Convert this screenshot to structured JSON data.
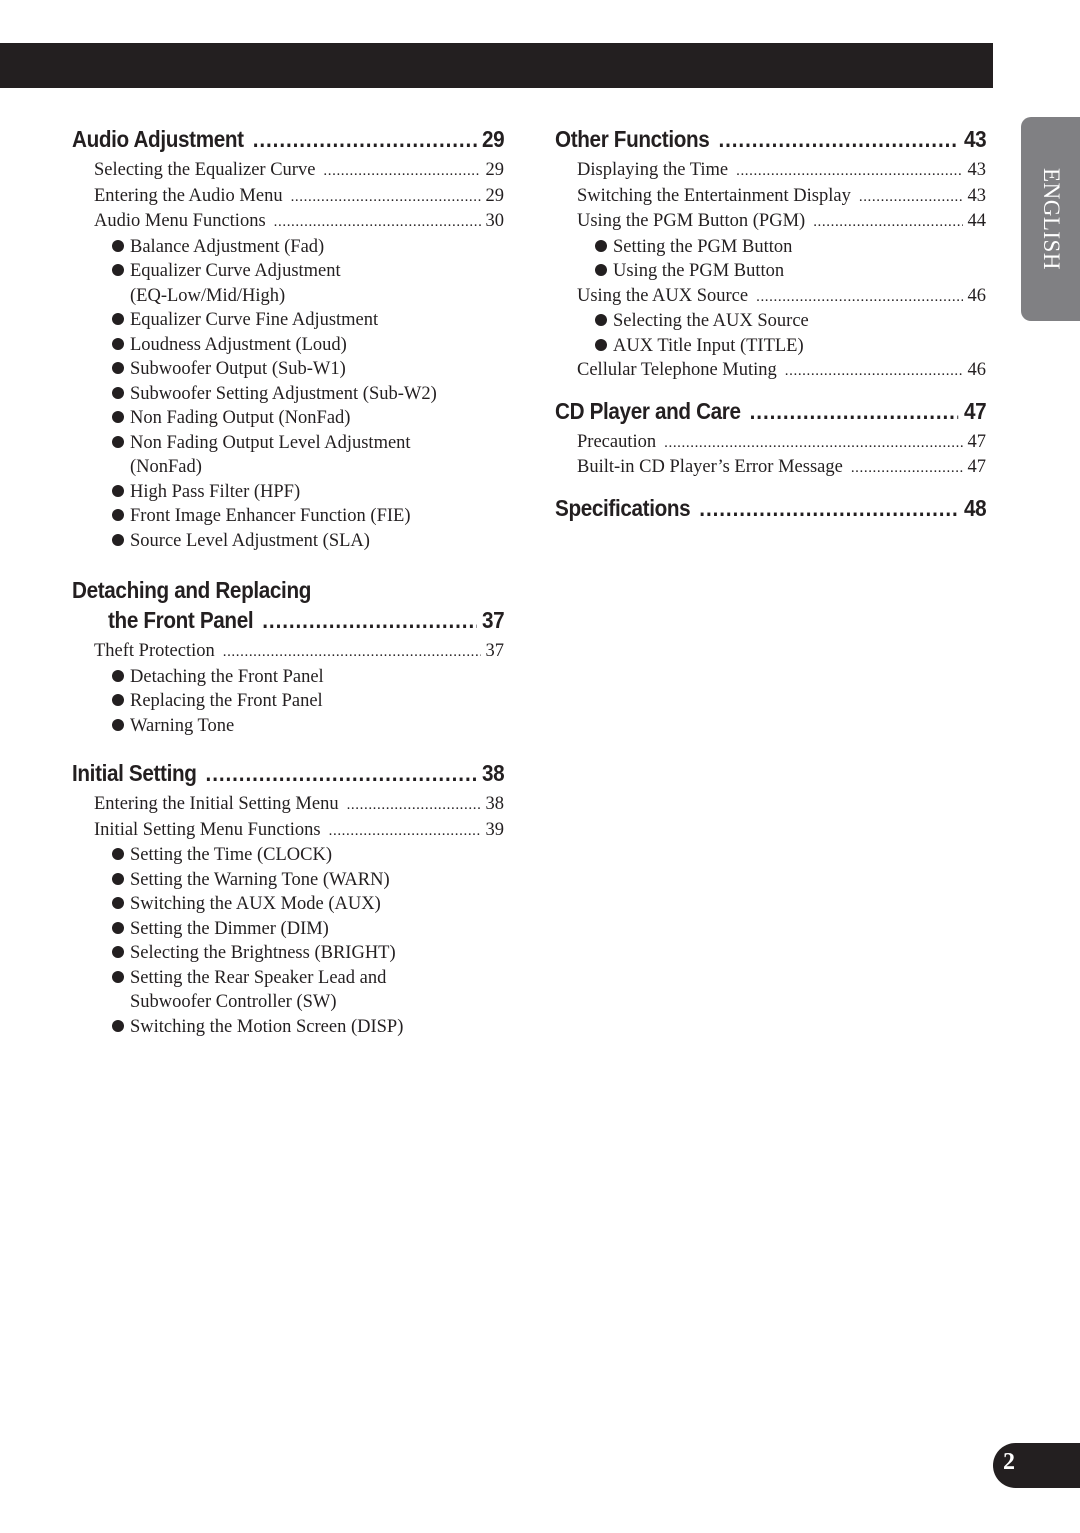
{
  "language_tab": "ENGLISH",
  "page_number": "2",
  "left_column": [
    {
      "title": "Audio Adjustment",
      "title_line2": null,
      "page": "29",
      "entries": [
        {
          "type": "entry",
          "label": "Selecting the Equalizer Curve",
          "page": "29"
        },
        {
          "type": "entry",
          "label": "Entering the Audio Menu",
          "page": "29"
        },
        {
          "type": "entry",
          "label": "Audio Menu Functions",
          "page": "30"
        },
        {
          "type": "bullet",
          "label": "Balance Adjustment (Fad)"
        },
        {
          "type": "bullet",
          "label": "Equalizer Curve Adjustment",
          "label2": "(EQ-Low/Mid/High)"
        },
        {
          "type": "bullet",
          "label": "Equalizer Curve Fine Adjustment"
        },
        {
          "type": "bullet",
          "label": "Loudness Adjustment (Loud)"
        },
        {
          "type": "bullet",
          "label": "Subwoofer Output (Sub-W1)"
        },
        {
          "type": "bullet",
          "label": "Subwoofer Setting Adjustment (Sub-W2)"
        },
        {
          "type": "bullet",
          "label": "Non Fading Output (NonFad)"
        },
        {
          "type": "bullet",
          "label": "Non Fading Output Level Adjustment",
          "label2": "(NonFad)"
        },
        {
          "type": "bullet",
          "label": "High Pass Filter (HPF)"
        },
        {
          "type": "bullet",
          "label": "Front Image Enhancer Function (FIE)"
        },
        {
          "type": "bullet",
          "label": "Source Level Adjustment (SLA)"
        }
      ]
    },
    {
      "title": "Detaching and Replacing",
      "title_line2": "the Front Panel",
      "page": "37",
      "entries": [
        {
          "type": "entry",
          "label": "Theft Protection",
          "page": "37"
        },
        {
          "type": "bullet",
          "label": "Detaching the Front Panel"
        },
        {
          "type": "bullet",
          "label": "Replacing the Front Panel"
        },
        {
          "type": "bullet",
          "label": "Warning Tone"
        }
      ]
    },
    {
      "title": "Initial Setting",
      "title_line2": null,
      "page": "38",
      "entries": [
        {
          "type": "entry",
          "label": "Entering the Initial Setting Menu",
          "page": "38"
        },
        {
          "type": "entry",
          "label": "Initial Setting Menu Functions",
          "page": "39"
        },
        {
          "type": "bullet",
          "label": "Setting the Time (CLOCK)"
        },
        {
          "type": "bullet",
          "label": "Setting the Warning Tone (WARN)"
        },
        {
          "type": "bullet",
          "label": "Switching the AUX Mode (AUX)"
        },
        {
          "type": "bullet",
          "label": "Setting the Dimmer (DIM)"
        },
        {
          "type": "bullet",
          "label": "Selecting the Brightness (BRIGHT)"
        },
        {
          "type": "bullet",
          "label": "Setting the Rear Speaker Lead and",
          "label2": "Subwoofer Controller (SW)"
        },
        {
          "type": "bullet",
          "label": "Switching the Motion Screen (DISP)"
        }
      ]
    }
  ],
  "right_column": [
    {
      "title": "Other Functions",
      "title_line2": null,
      "page": "43",
      "entries": [
        {
          "type": "entry",
          "label": "Displaying the Time",
          "page": "43"
        },
        {
          "type": "entry",
          "label": "Switching the Entertainment Display",
          "page": "43"
        },
        {
          "type": "entry",
          "label": "Using the PGM Button (PGM)",
          "page": "44"
        },
        {
          "type": "bullet",
          "label": "Setting the PGM Button"
        },
        {
          "type": "bullet",
          "label": "Using the PGM Button"
        },
        {
          "type": "entry",
          "label": "Using the AUX Source",
          "page": "46"
        },
        {
          "type": "bullet",
          "label": "Selecting the AUX Source"
        },
        {
          "type": "bullet",
          "label": "AUX Title Input (TITLE)"
        },
        {
          "type": "entry",
          "label": "Cellular Telephone Muting",
          "page": "46"
        }
      ]
    },
    {
      "title": "CD Player and Care",
      "title_line2": null,
      "page": "47",
      "entries": [
        {
          "type": "entry",
          "label": "Precaution",
          "page": "47"
        },
        {
          "type": "entry",
          "label": "Built-in CD Player’s Error Message",
          "page": "47"
        }
      ]
    },
    {
      "title": "Specifications",
      "title_line2": null,
      "page": "48",
      "entries": []
    }
  ]
}
